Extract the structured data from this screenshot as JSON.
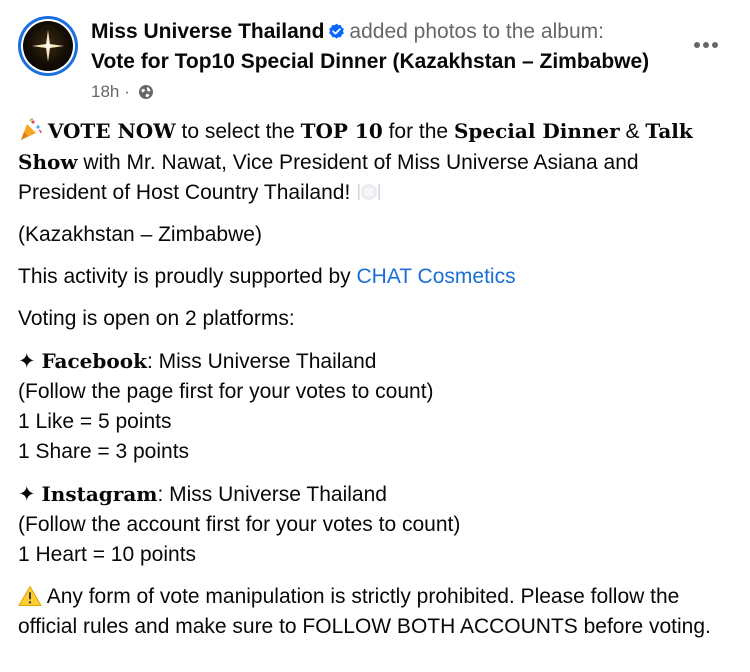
{
  "post": {
    "page_name": "Miss Universe Thailand",
    "action_text": "added photos to the album:",
    "album_title": "Vote for Top10 Special Dinner (Kazakhstan – Zimbabwe)",
    "timestamp": "18h",
    "separator": "·",
    "privacy_icon": "globe-icon",
    "more_icon": "more-dots-icon"
  },
  "body": {
    "p1": {
      "vote_now": "VOTE NOW",
      "t1": " to select the ",
      "top10": "TOP 10",
      "t2": " for the ",
      "special_dinner": "Special Dinner",
      "amp": " & ",
      "talk_show": "Talk Show",
      "t3": " with Mr. Nawat, Vice President of Miss Universe Asiana and President of Host Country Thailand!"
    },
    "p2": "(Kazakhstan – Zimbabwe)",
    "p3": {
      "text": "This activity is proudly supported by ",
      "link": "CHAT Cosmetics"
    },
    "p4": "Voting is open on 2 platforms:",
    "p5": {
      "star": "✦ ",
      "platform": "Facebook",
      "colon_text": ": Miss Universe Thailand",
      "line2": "(Follow the page first for your votes to count)",
      "line3": "1 Like = 5 points",
      "line4": "1 Share = 3 points"
    },
    "p6": {
      "star": "✦ ",
      "platform": "Instagram",
      "colon_text": ": Miss Universe Thailand",
      "line2": "(Follow the account first for your votes to count)",
      "line3": "1 Heart = 10 points"
    },
    "p7": "Any form of vote manipulation is strictly prohibited. Please follow the official rules and make sure to FOLLOW BOTH ACCOUNTS before voting."
  },
  "colors": {
    "link": "#1a6ed8",
    "verified": "#0866ff",
    "secondary_text": "#65676b"
  }
}
